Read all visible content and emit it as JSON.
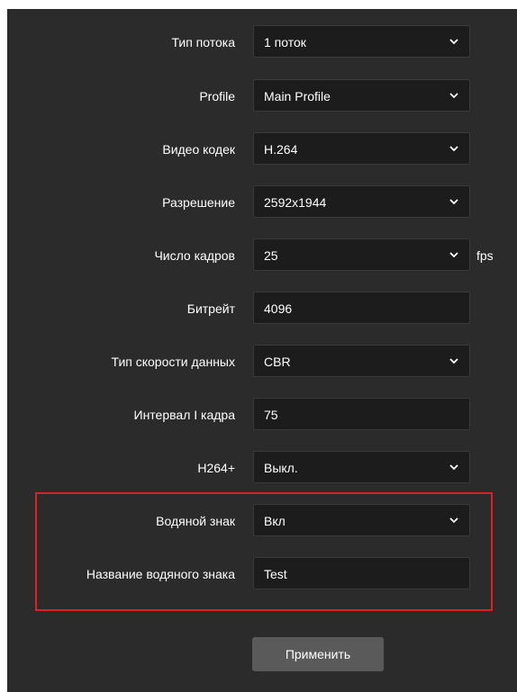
{
  "form": {
    "fields": [
      {
        "label": "Тип потока",
        "value": "1 поток",
        "control": "select"
      },
      {
        "label": "Profile",
        "value": "Main Profile",
        "control": "select"
      },
      {
        "label": "Видео кодек",
        "value": "H.264",
        "control": "select"
      },
      {
        "label": "Разрешение",
        "value": "2592x1944",
        "control": "select"
      },
      {
        "label": "Число кадров",
        "value": "25",
        "control": "select",
        "unit": "fps"
      },
      {
        "label": "Битрейт",
        "value": "4096",
        "control": "input"
      },
      {
        "label": "Тип скорости данных",
        "value": "CBR",
        "control": "select"
      },
      {
        "label": "Интервал I кадра",
        "value": "75",
        "control": "input"
      },
      {
        "label": "H264+",
        "value": "Выкл.",
        "control": "select"
      },
      {
        "label": "Водяной знак",
        "value": "Вкл",
        "control": "select"
      },
      {
        "label": "Название водяного знака",
        "value": "Test",
        "control": "input"
      }
    ],
    "apply_label": "Применить"
  },
  "colors": {
    "panel_bg": "#2b2b2b",
    "field_bg": "#1c1c1c",
    "button_bg": "#5a5a5a",
    "highlight_border": "#e02020"
  },
  "icons": {
    "dropdown": "chevron-down-icon"
  }
}
